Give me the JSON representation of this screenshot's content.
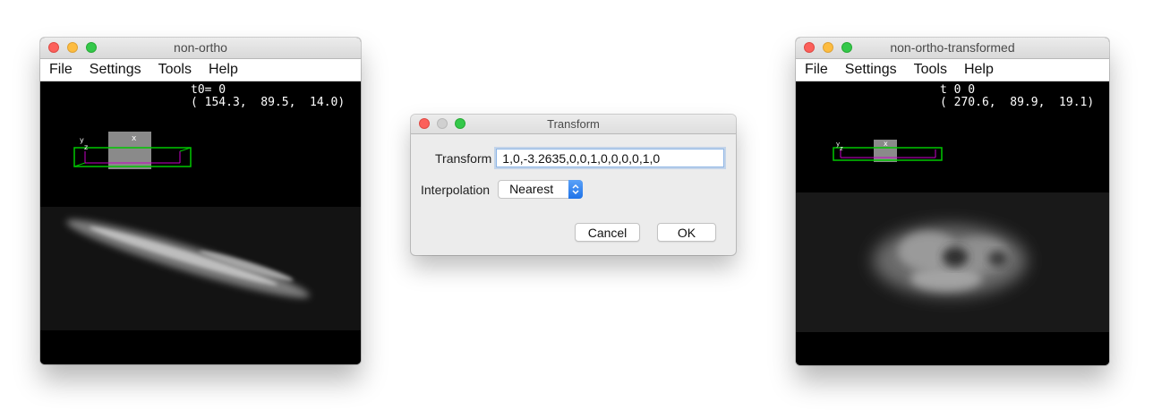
{
  "left_window": {
    "title": "non-ortho",
    "menu": [
      "File",
      "Settings",
      "Tools",
      "Help"
    ],
    "readout_line1": "t0= 0",
    "readout_line2": "( 154.3,  89.5,  14.0)",
    "axis_x": "x",
    "axis_y": "y",
    "axis_z": "z"
  },
  "dialog": {
    "title": "Transform",
    "transform_label": "Transform",
    "transform_value": "1,0,-3.2635,0,0,1,0,0,0,0,1,0",
    "interpolation_label": "Interpolation",
    "interpolation_value": "Nearest",
    "cancel_label": "Cancel",
    "ok_label": "OK"
  },
  "right_window": {
    "title": "non-ortho-transformed",
    "menu": [
      "File",
      "Settings",
      "Tools",
      "Help"
    ],
    "readout_line1": "t 0 0",
    "readout_line2": "( 270.6,  89.9,  19.1)",
    "axis_x": "x",
    "axis_y": "y",
    "axis_z": "z"
  },
  "colors": {
    "close": "#fc605b",
    "minimize": "#fdbc40",
    "zoom": "#34c84a",
    "bbox_green": "#00c800",
    "bbox_magenta": "#c800c8",
    "select_accent": "#1f73e8"
  }
}
